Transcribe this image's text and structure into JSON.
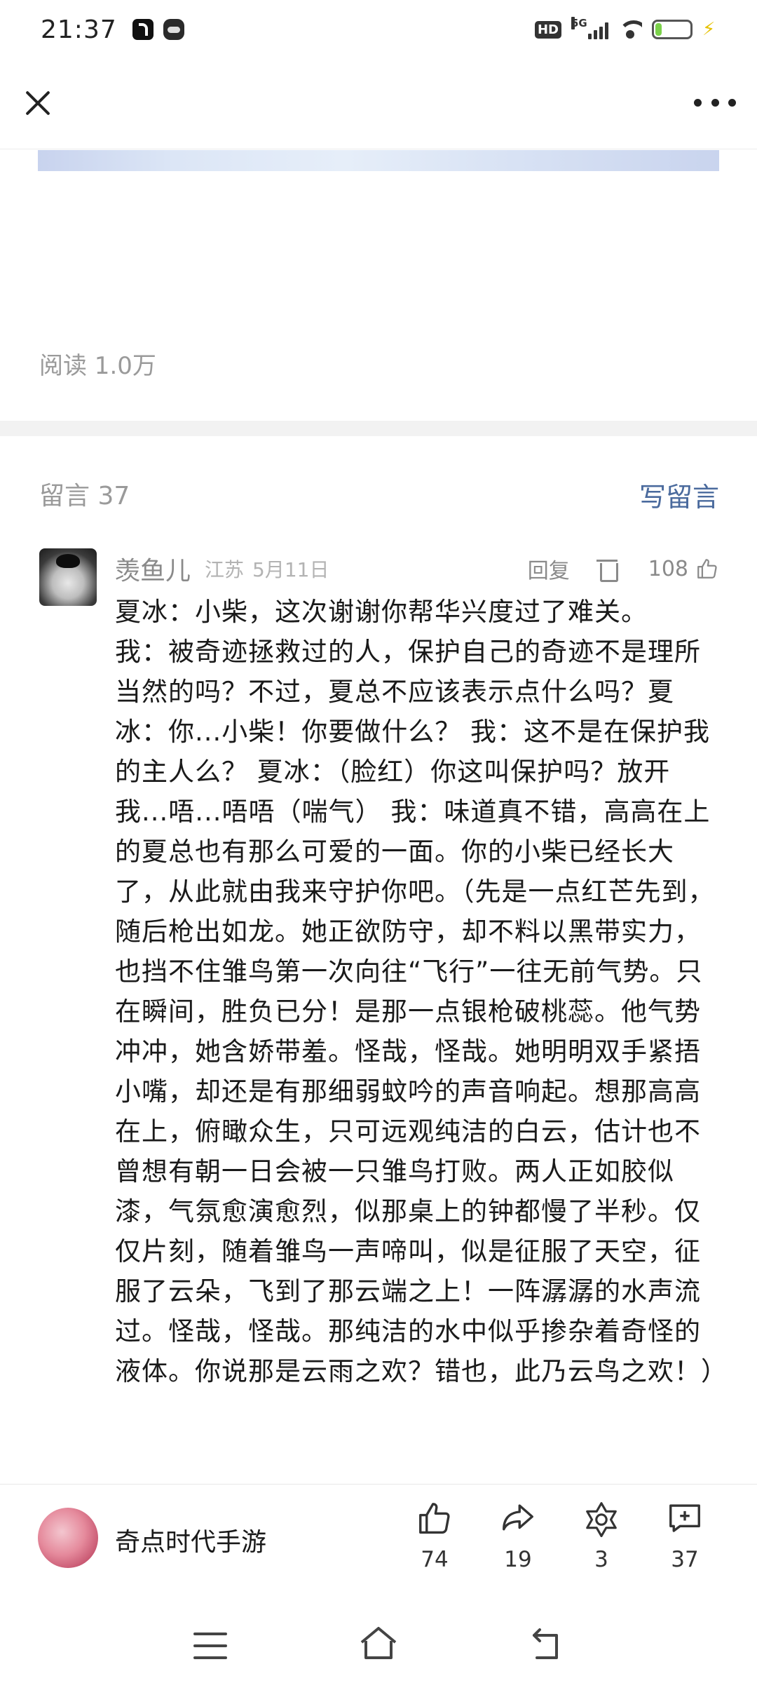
{
  "status_bar": {
    "time": "21:37",
    "network": "5G",
    "hd": "HD",
    "battery": "17",
    "battery_fraction": 0.17
  },
  "nav": {
    "close_icon": "close-icon",
    "more_icon": "more-icon"
  },
  "article": {
    "read_count": "阅读 1.0万"
  },
  "comments": {
    "header": "留言 37",
    "write_label": "写留言",
    "items": [
      {
        "name": "羡鱼儿",
        "location": "江苏",
        "date": "5月11日",
        "reply_label": "回复",
        "likes": "108",
        "text": "夏冰：小柴，这次谢谢你帮华兴度过了难关。\n我：被奇迹拯救过的人，保护自己的奇迹不是理所当然的吗？不过，夏总不应该表示点什么吗？夏冰：你...小柴！你要做什么？ 我：这不是在保护我的主人么？ 夏冰：（脸红）你这叫保护吗？放开我...唔...唔唔（喘气） 我：味道真不错，高高在上的夏总也有那么可爱的一面。你的小柴已经长大了，从此就由我来守护你吧。（先是一点红芒先到，随后枪出如龙。她正欲防守，却不料以黑带实力，也挡不住雏鸟第一次向往“飞行”一往无前气势。只在瞬间，胜负已分！是那一点银枪破桃蕊。他气势冲冲，她含娇带羞。怪哉，怪哉。她明明双手紧捂小嘴，却还是有那细弱蚊吟的声音响起。想那高高在上，俯瞰众生，只可远观纯洁的白云，估计也不曾想有朝一日会被一只雏鸟打败。两人正如胶似漆，气氛愈演愈烈，似那桌上的钟都慢了半秒。仅仅片刻，随着雏鸟一声啼叫，似是征服了天空，征服了云朵，飞到了那云端之上！一阵潺潺的水声流过。怪哉，怪哉。那纯洁的水中似乎掺杂着奇怪的液体。你说那是云雨之欢？错也，此乃云鸟之欢！）"
      }
    ]
  },
  "bottom_bar": {
    "account_name": "奇点时代手游",
    "like_count": "74",
    "share_count": "19",
    "favorite_count": "3",
    "comment_count": "37"
  }
}
